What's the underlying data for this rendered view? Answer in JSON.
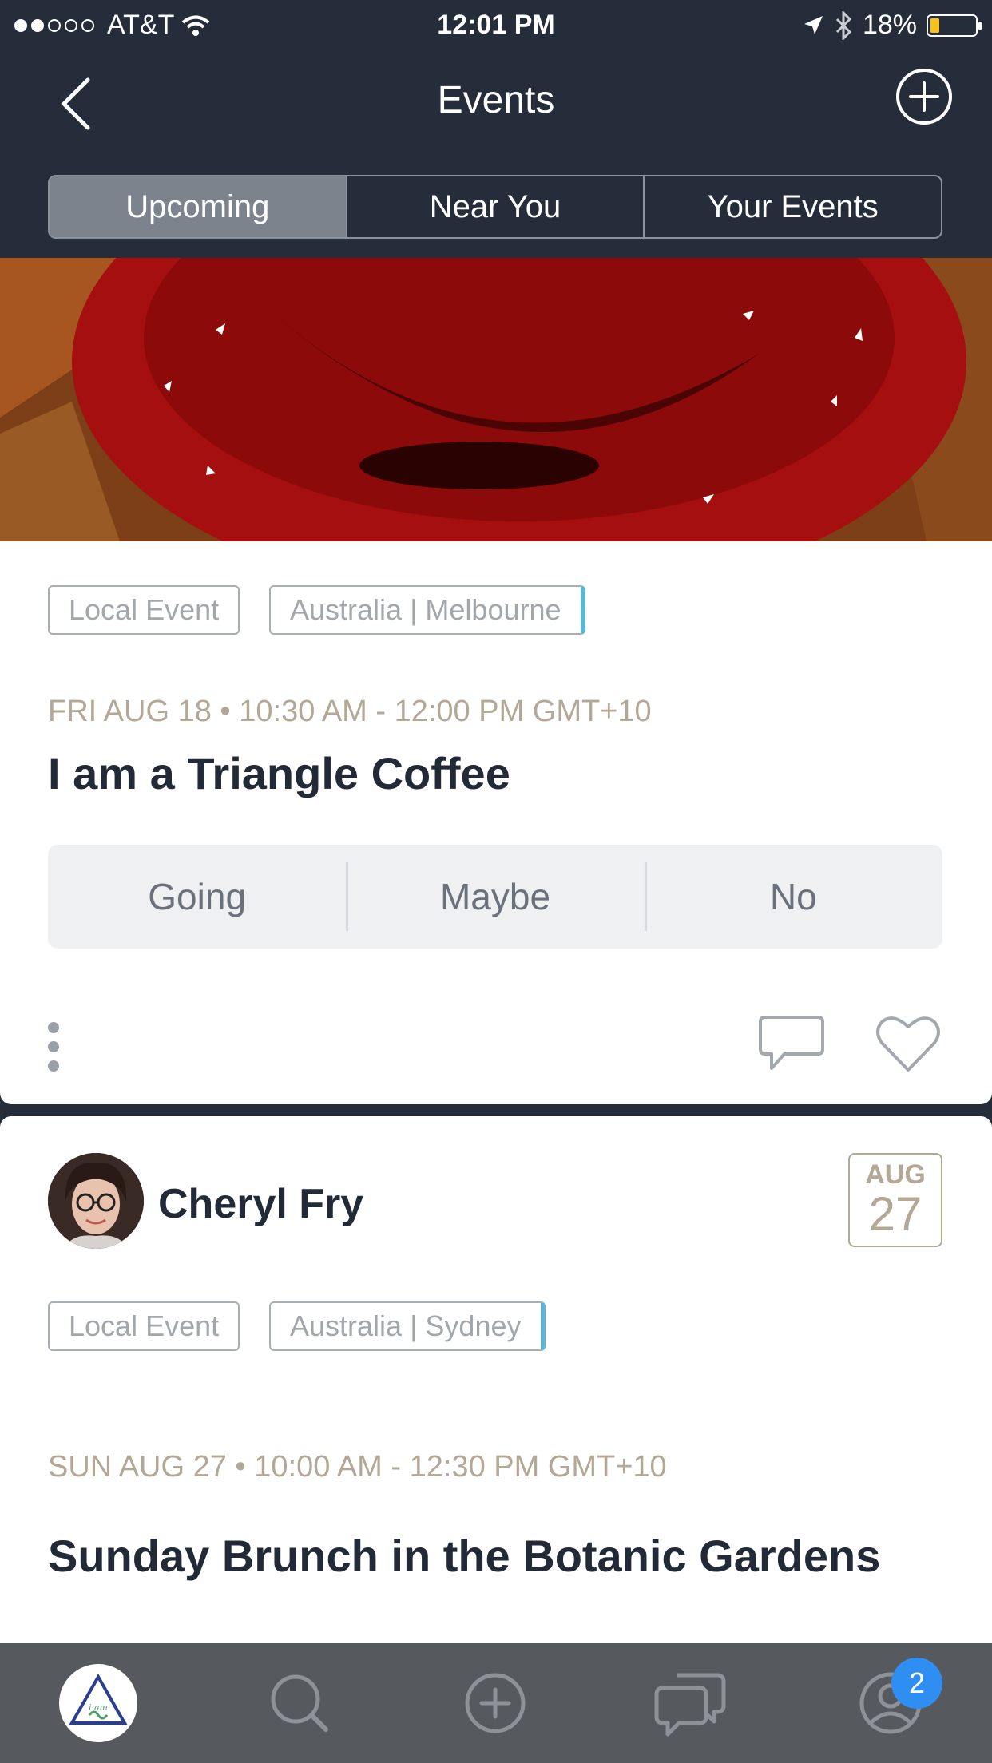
{
  "status": {
    "carrier": "AT&T",
    "time": "12:01 PM",
    "battery": "18%",
    "battery_fraction": 0.18,
    "signal_bars": 2
  },
  "header": {
    "title": "Events"
  },
  "segments": [
    {
      "label": "Upcoming",
      "active": true
    },
    {
      "label": "Near You",
      "active": false
    },
    {
      "label": "Your Events",
      "active": false
    }
  ],
  "event1": {
    "tags": [
      "Local Event",
      "Australia | Melbourne"
    ],
    "datetime": "FRI AUG 18 • 10:30 AM - 12:00 PM GMT+10",
    "title": "I am a Triangle Coffee",
    "rsvp": [
      "Going",
      "Maybe",
      "No"
    ]
  },
  "event2": {
    "host": "Cheryl Fry",
    "date_month": "AUG",
    "date_day": "27",
    "tags": [
      "Local Event",
      "Australia | Sydney"
    ],
    "datetime": "SUN AUG 27 • 10:00 AM - 12:30 PM GMT+10",
    "title": "Sunday Brunch in the Botanic Gardens"
  },
  "tabbar": {
    "notification_count": "2",
    "icons": [
      "app-logo-icon",
      "search-icon",
      "add-icon",
      "chat-icon",
      "profile-icon"
    ]
  },
  "colors": {
    "nav_bg": "#252c3a",
    "accent_blue": "#5ab7d8",
    "badge": "#2f8ef2",
    "meta": "#b3a796"
  }
}
